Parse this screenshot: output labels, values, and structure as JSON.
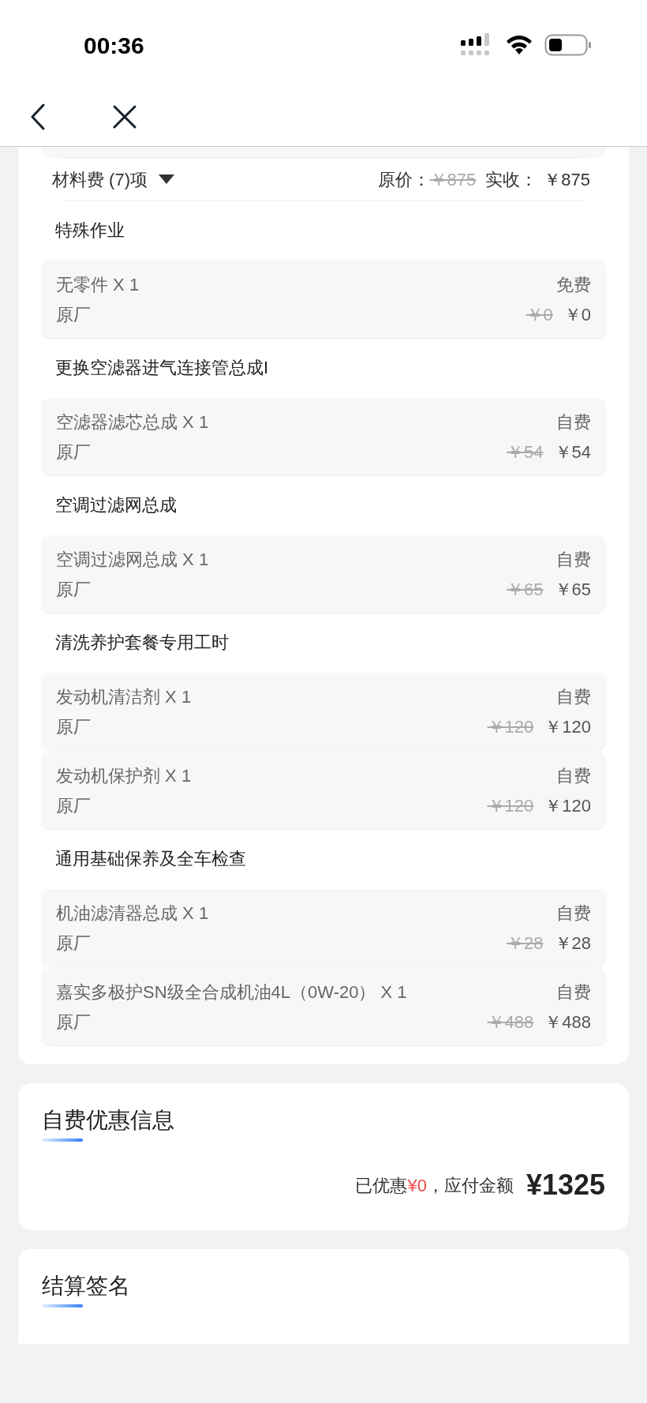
{
  "status_bar": {
    "time": "00:36"
  },
  "summary": {
    "label": "材料费 (7)项",
    "original_price_label": "原价：",
    "original_price": "￥875",
    "actual_label": "实收：",
    "actual_price": "￥875"
  },
  "groups": [
    {
      "title": "特殊作业",
      "items": [
        {
          "name": "无零件 X 1",
          "source": "原厂",
          "payment": "免费",
          "original_price": "￥0",
          "price": "￥0"
        }
      ]
    },
    {
      "title": "更换空滤器进气连接管总成I",
      "items": [
        {
          "name": "空滤器滤芯总成 X 1",
          "source": "原厂",
          "payment": "自费",
          "original_price": "￥54",
          "price": "￥54"
        }
      ]
    },
    {
      "title": "空调过滤网总成",
      "items": [
        {
          "name": "空调过滤网总成 X 1",
          "source": "原厂",
          "payment": "自费",
          "original_price": "￥65",
          "price": "￥65"
        }
      ]
    },
    {
      "title": "清洗养护套餐专用工时",
      "items": [
        {
          "name": "发动机清洁剂 X 1",
          "source": "原厂",
          "payment": "自费",
          "original_price": "￥120",
          "price": "￥120"
        },
        {
          "name": "发动机保护剂 X 1",
          "source": "原厂",
          "payment": "自费",
          "original_price": "￥120",
          "price": "￥120"
        }
      ]
    },
    {
      "title": "通用基础保养及全车检查",
      "items": [
        {
          "name": "机油滤清器总成 X 1",
          "source": "原厂",
          "payment": "自费",
          "original_price": "￥28",
          "price": "￥28"
        },
        {
          "name": "嘉实多极护SN级全合成机油4L（0W-20） X 1",
          "source": "原厂",
          "payment": "自费",
          "original_price": "￥488",
          "price": "￥488"
        }
      ]
    }
  ],
  "discount": {
    "title": "自费优惠信息",
    "discount_prefix": "已优惠",
    "discount_amount": "¥0",
    "discount_suffix": "，应付金额",
    "total": "¥1325"
  },
  "settlement": {
    "title": "结算签名"
  }
}
